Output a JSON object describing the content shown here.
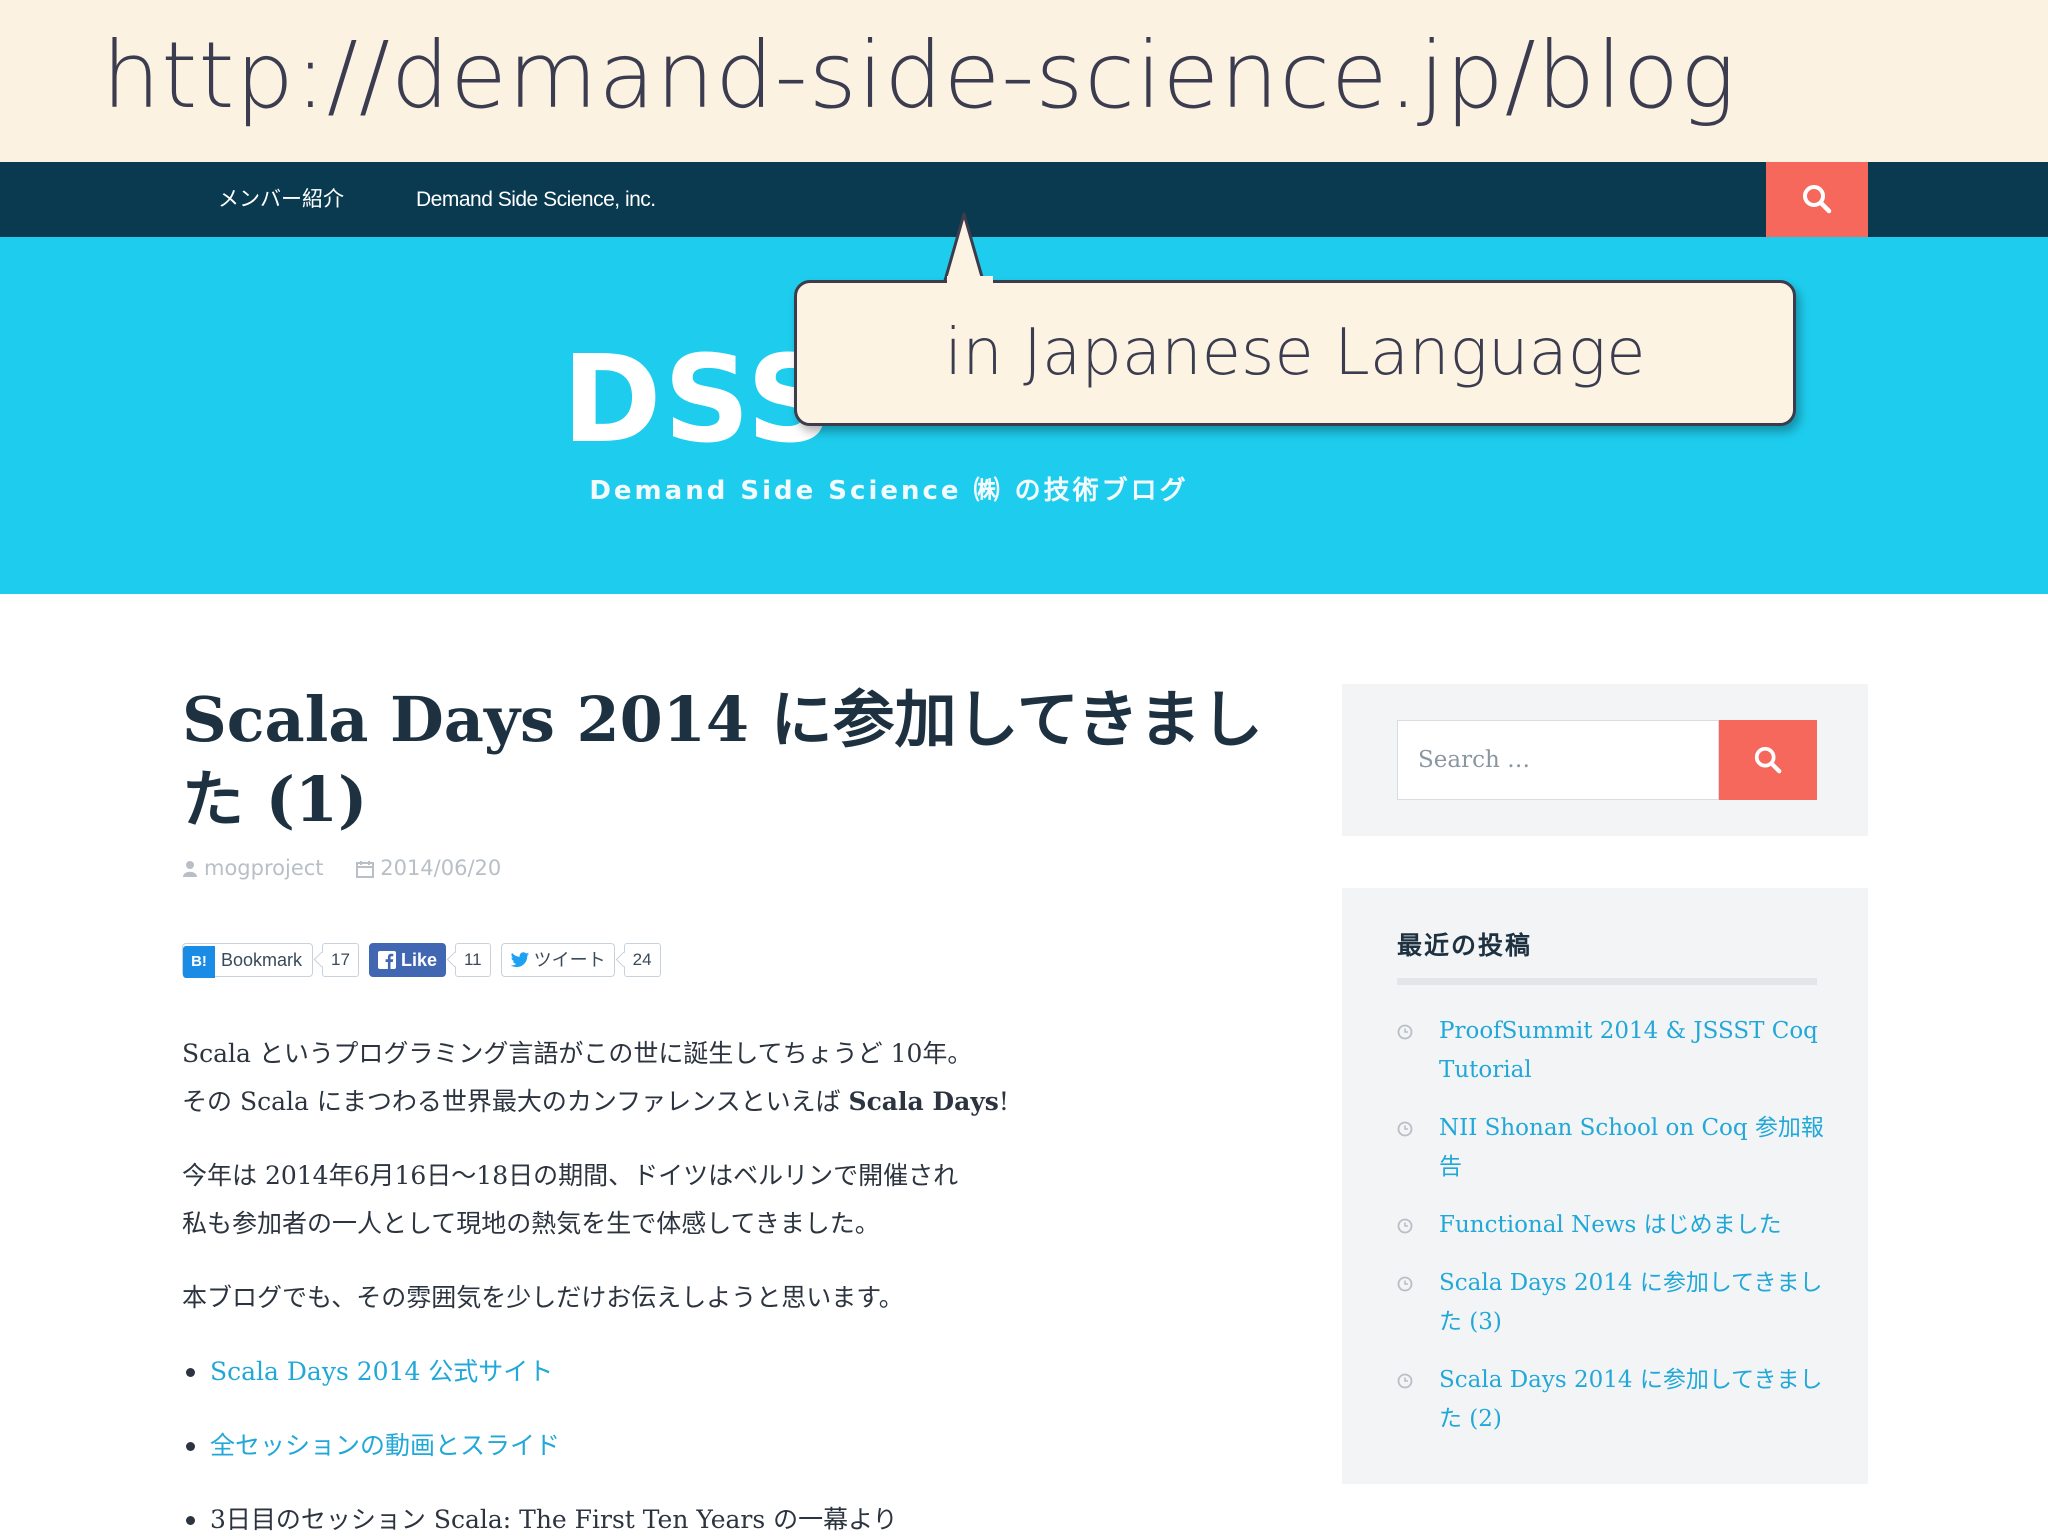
{
  "banner": {
    "url": "http://demand-side-science.jp/blog"
  },
  "navbar": {
    "items": [
      {
        "label": "メンバー紹介"
      },
      {
        "label": "Demand Side Science, inc."
      }
    ]
  },
  "hero": {
    "title": "DSS",
    "tagline": "Demand Side Science ㈱ の技術ブログ"
  },
  "callout": {
    "text": "in Japanese Language"
  },
  "post": {
    "title": "Scala Days 2014 に参加してきました (1)",
    "author": "mogproject",
    "date": "2014/06/20",
    "share": {
      "hatena_badge": "B!",
      "hatena_label": "Bookmark",
      "hatena_count": "17",
      "fb_label": "Like",
      "fb_count": "11",
      "tw_label": "ツイート",
      "tw_count": "24"
    },
    "paragraphs": [
      {
        "line1": "Scala というプログラミング言語がこの世に誕生してちょうど 10年。",
        "line2_pre": "その Scala にまつわる世界最大のカンファレンスといえば ",
        "line2_strong": "Scala Days",
        "line2_post": "!"
      },
      {
        "line1": "今年は 2014年6月16日〜18日の期間、ドイツはベルリンで開催され",
        "line2": "私も参加者の一人として現地の熱気を生で体感してきました。"
      },
      {
        "line1": "本ブログでも、その雰囲気を少しだけお伝えしようと思います。"
      }
    ],
    "links": [
      {
        "label": "Scala Days 2014 公式サイト"
      },
      {
        "label": "全セッションの動画とスライド"
      }
    ],
    "trailing_item": "3日目のセッション Scala: The First Ten Years の一幕より"
  },
  "sidebar": {
    "search_placeholder": "Search …",
    "recent_title": "最近の投稿",
    "recent_posts": [
      {
        "label": "ProofSummit 2014 & JSSST Coq Tutorial"
      },
      {
        "label": "NII Shonan School on Coq 参加報告"
      },
      {
        "label": "Functional News はじめました"
      },
      {
        "label": "Scala Days 2014 に参加してきました (3)"
      },
      {
        "label": "Scala Days 2014 に参加してきました (2)"
      }
    ]
  },
  "colors": {
    "banner_bg": "#fcf2e2",
    "navbar_bg": "#0a3a50",
    "hero_bg": "#1ecdee",
    "accent": "#f7685c",
    "link": "#22a8d8"
  }
}
